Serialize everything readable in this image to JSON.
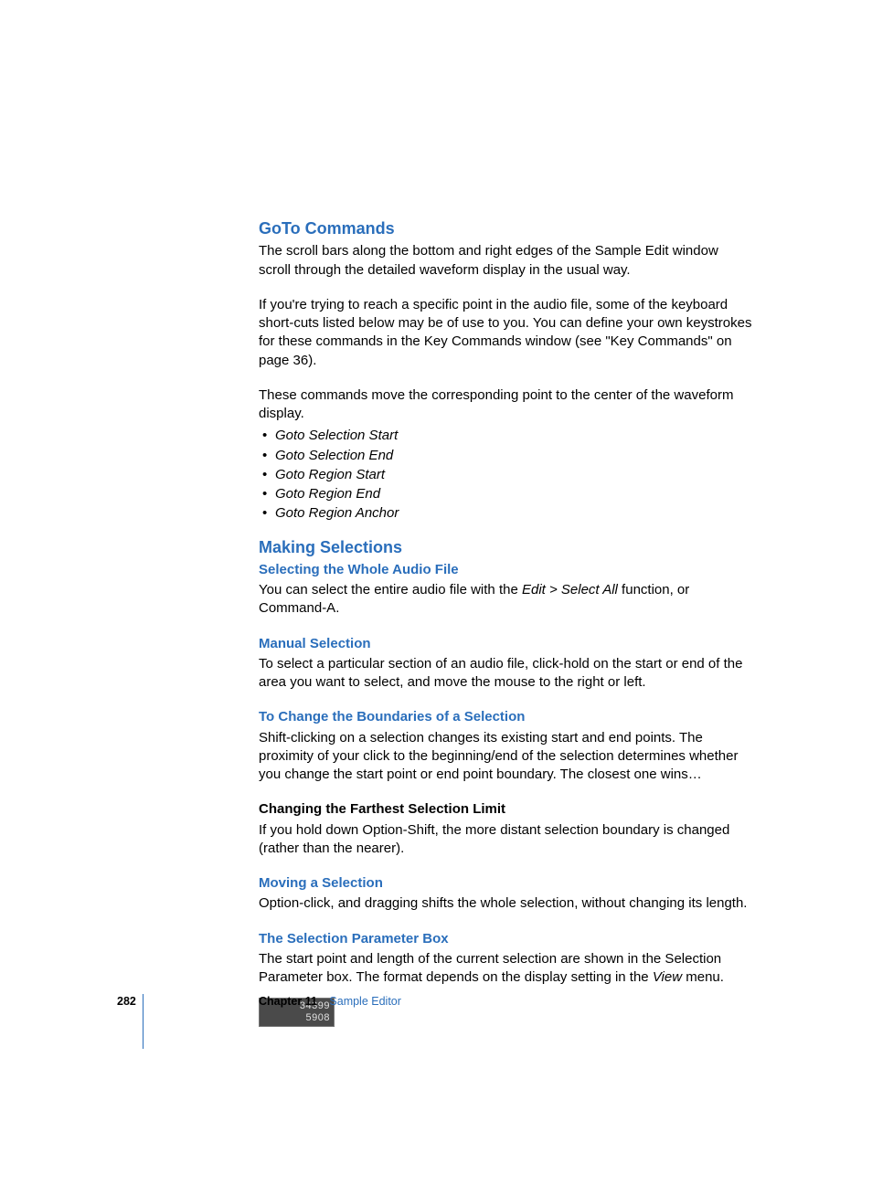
{
  "goto": {
    "title": "GoTo Commands",
    "p1": "The scroll bars along the bottom and right edges of the Sample Edit window scroll through the detailed waveform display in the usual way.",
    "p2": "If you're trying to reach a specific point in the audio file, some of the keyboard short-cuts listed below may be of use to you. You can define your own keystrokes for these commands in the Key Commands window (see \"Key Commands\" on page 36).",
    "p3": "These commands move the corresponding point to the center of the waveform display.",
    "items": [
      "Goto Selection Start",
      "Goto Selection End",
      "Goto Region Start",
      "Goto Region End",
      "Goto Region Anchor"
    ]
  },
  "making": {
    "title": "Making Selections",
    "whole": {
      "title": "Selecting the Whole Audio File",
      "p_a": "You can select the entire audio file with the ",
      "p_i": "Edit > Select All",
      "p_b": " function, or Command-A."
    },
    "manual": {
      "title": "Manual Selection",
      "p": "To select a particular section of an audio file, click-hold on the start or end of the area you want to select, and move the mouse to the right or left."
    },
    "change": {
      "title": "To Change the Boundaries of a Selection",
      "p": "Shift-clicking on a selection changes its existing start and end points. The proximity of your click to the beginning/end of the selection determines whether you change the start point or end point boundary. The closest one wins…"
    },
    "farthest": {
      "title": "Changing the Farthest Selection Limit",
      "p": "If you hold down Option-Shift, the more distant selection boundary is changed (rather than the nearer)."
    },
    "moving": {
      "title": "Moving a Selection",
      "p": "Option-click, and dragging shifts the whole selection, without changing its length."
    },
    "param": {
      "title": "The Selection Parameter Box",
      "p_a": "The start point and length of the current selection are shown in the Selection Parameter box. The format depends on the display setting in the ",
      "p_i": "View",
      "p_b": " menu.",
      "box_line1": "34399",
      "box_line2": "5908"
    }
  },
  "footer": {
    "page": "282",
    "chapter": "Chapter 11",
    "title": "Sample Editor"
  }
}
